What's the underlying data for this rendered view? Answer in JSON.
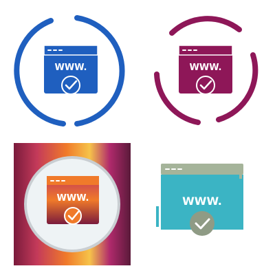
{
  "icons": [
    {
      "name": "blue-circle-variant",
      "style": "glyph-circle",
      "url_text": "WWW.",
      "colors": {
        "primary": "#1f5fbf",
        "light": "#ffffff"
      }
    },
    {
      "name": "purple-circle-variant",
      "style": "glyph-circle",
      "url_text": "WWW.",
      "colors": {
        "primary": "#8e1758",
        "light": "#ffffff"
      }
    },
    {
      "name": "gradient-square-variant",
      "style": "gradient",
      "url_text": "WWW.",
      "colors": {
        "stops": [
          "#7a1b3c",
          "#c43a5a",
          "#f07a2a",
          "#f6c34a",
          "#b12a6c",
          "#5a1a3a"
        ],
        "inner": "#eef3f5",
        "ring": "#c9ced2"
      }
    },
    {
      "name": "flat-color-variant",
      "style": "flat",
      "url_text": "WWW.",
      "colors": {
        "header": "#a5b49a",
        "body": "#3bb4c4",
        "check_circle": "#8f9b85",
        "light": "#ffffff"
      }
    }
  ]
}
